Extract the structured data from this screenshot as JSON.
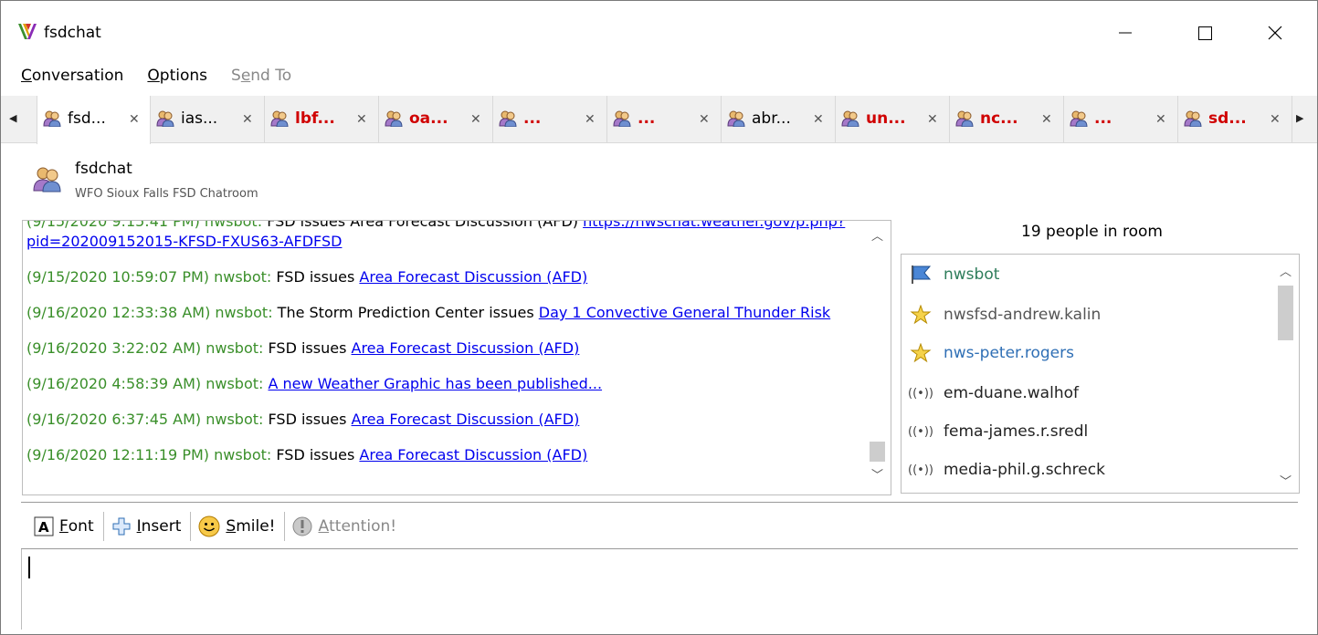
{
  "window": {
    "title": "fsdchat"
  },
  "menu": {
    "items": [
      {
        "label_pre": "",
        "label_u": "C",
        "label_post": "onversation",
        "enabled": true
      },
      {
        "label_pre": "",
        "label_u": "O",
        "label_post": "ptions",
        "enabled": true
      },
      {
        "label_pre": "S",
        "label_u": "e",
        "label_post": "nd To",
        "enabled": false
      }
    ]
  },
  "tabs": [
    {
      "label": "fsd...",
      "red": false,
      "active": true
    },
    {
      "label": "ias...",
      "red": false,
      "active": false
    },
    {
      "label": "lbf...",
      "red": true,
      "active": false
    },
    {
      "label": "oa...",
      "red": true,
      "active": false
    },
    {
      "label": "...",
      "red": true,
      "active": false
    },
    {
      "label": "...",
      "red": true,
      "active": false
    },
    {
      "label": "abr...",
      "red": false,
      "active": false
    },
    {
      "label": "un...",
      "red": true,
      "active": false
    },
    {
      "label": "nc...",
      "red": true,
      "active": false
    },
    {
      "label": "...",
      "red": true,
      "active": false
    },
    {
      "label": "sd...",
      "red": true,
      "active": false
    }
  ],
  "room": {
    "name": "fsdchat",
    "description": "WFO Sioux Falls FSD Chatroom"
  },
  "chat": {
    "messages": [
      {
        "ts": "(9/15/2020 9:15:41 PM)",
        "sender": "nwsbot:",
        "text": "FSD issues Area Forecast Discussion (AFD)",
        "link": "https://nwschat.weather.gov/p.php?pid=202009152015-KFSD-FXUS63-AFDFSD",
        "partial": true
      },
      {
        "ts": "(9/15/2020 10:59:07 PM)",
        "sender": "nwsbot:",
        "text": "FSD issues",
        "link": "Area Forecast Discussion (AFD)"
      },
      {
        "ts": "(9/16/2020 12:33:38 AM)",
        "sender": "nwsbot:",
        "text": "The Storm Prediction Center issues",
        "link": "Day 1 Convective General Thunder Risk"
      },
      {
        "ts": "(9/16/2020 3:22:02 AM)",
        "sender": "nwsbot:",
        "text": "FSD issues",
        "link": "Area Forecast Discussion (AFD)"
      },
      {
        "ts": "(9/16/2020 4:58:39 AM)",
        "sender": "nwsbot:",
        "text": "",
        "link": "A new Weather Graphic has been published... "
      },
      {
        "ts": "(9/16/2020 6:37:45 AM)",
        "sender": "nwsbot:",
        "text": "FSD issues",
        "link": "Area Forecast Discussion (AFD)"
      },
      {
        "ts": "(9/16/2020 12:11:19 PM)",
        "sender": "nwsbot:",
        "text": "FSD issues",
        "link": "Area Forecast Discussion (AFD)"
      }
    ]
  },
  "people": {
    "count_label": "19 people in room",
    "list": [
      {
        "name": "nwsbot",
        "icon": "flag-icon",
        "style": "green"
      },
      {
        "name": "nwsfsd-andrew.kalin",
        "icon": "star-badge-icon",
        "style": "gray"
      },
      {
        "name": "nws-peter.rogers",
        "icon": "star-badge-icon",
        "style": "blue"
      },
      {
        "name": "em-duane.walhof",
        "icon": "broadcast-icon",
        "style": "plain"
      },
      {
        "name": "fema-james.r.sredl",
        "icon": "broadcast-icon",
        "style": "plain"
      },
      {
        "name": "media-phil.g.schreck",
        "icon": "broadcast-icon",
        "style": "plain"
      }
    ]
  },
  "toolbar": {
    "font": {
      "u": "F",
      "rest": "ont"
    },
    "insert": {
      "u": "I",
      "rest": "nsert"
    },
    "smile": {
      "u": "S",
      "rest": "mile!"
    },
    "attention": {
      "u": "A",
      "rest": "ttention!"
    }
  },
  "colors": {
    "timestamp": "#3a8f2a",
    "link": "#0000ee",
    "unread_tab": "#d00000"
  }
}
